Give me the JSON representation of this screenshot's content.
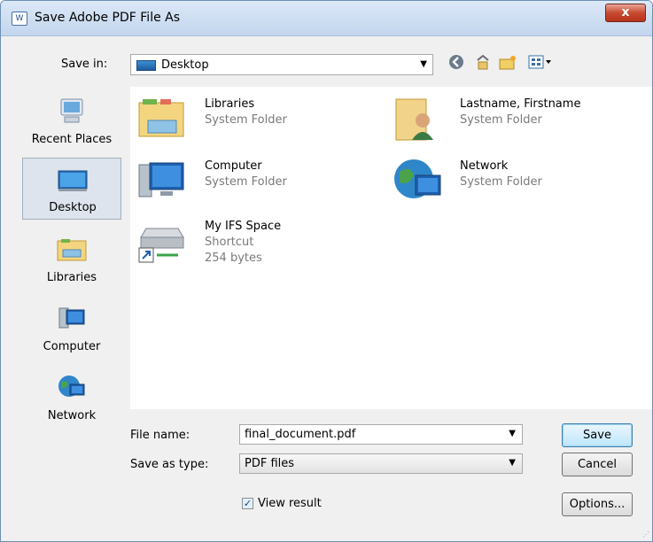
{
  "window": {
    "title": "Save Adobe PDF File As",
    "close_label": "x"
  },
  "toolbar": {
    "save_in_label": "Save in:",
    "save_in_value": "Desktop",
    "back_icon": "back-icon",
    "up_icon": "up-folder-icon",
    "new_folder_icon": "new-folder-icon",
    "views_icon": "views-menu-icon"
  },
  "places": [
    {
      "label": "Recent Places",
      "icon": "recent-places-icon"
    },
    {
      "label": "Desktop",
      "icon": "desktop-icon",
      "selected": true
    },
    {
      "label": "Libraries",
      "icon": "libraries-icon"
    },
    {
      "label": "Computer",
      "icon": "computer-icon"
    },
    {
      "label": "Network",
      "icon": "network-icon"
    }
  ],
  "files": [
    {
      "name": "Libraries",
      "type": "System Folder",
      "icon": "libraries-folder-icon"
    },
    {
      "name": "Lastname, Firstname",
      "type": "System Folder",
      "icon": "user-folder-icon"
    },
    {
      "name": "Computer",
      "type": "System Folder",
      "icon": "computer-icon"
    },
    {
      "name": "Network",
      "type": "System Folder",
      "icon": "network-icon"
    },
    {
      "name": "My IFS Space",
      "type": "Shortcut",
      "size": "254 bytes",
      "icon": "network-drive-shortcut-icon"
    }
  ],
  "form": {
    "file_name_label": "File name:",
    "file_name_value": "final_document.pdf",
    "save_as_type_label": "Save as type:",
    "save_as_type_value": "PDF files",
    "view_result_label": "View result",
    "view_result_checked": true
  },
  "buttons": {
    "save": "Save",
    "cancel": "Cancel",
    "options": "Options..."
  },
  "colors": {
    "title_bar": "#c3d6ee",
    "close_button": "#c84a31",
    "selected_place": "#dde4ed",
    "secondary_text": "#7a7a7a"
  }
}
